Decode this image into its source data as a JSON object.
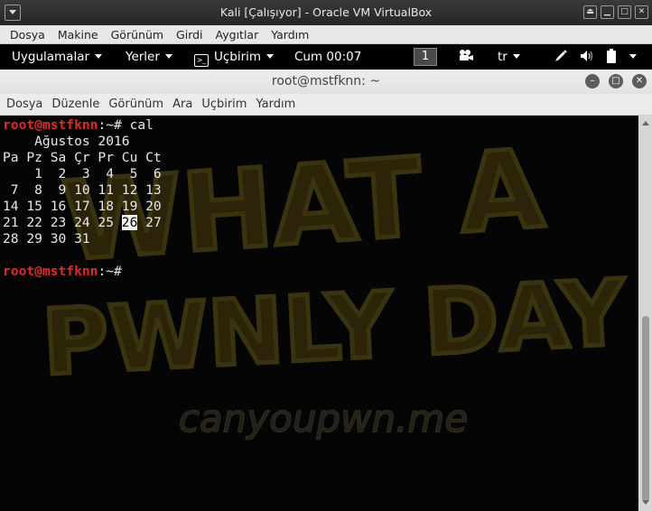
{
  "vbox": {
    "title": "Kali [Çalışıyor] - Oracle VM VirtualBox",
    "menu": [
      "Dosya",
      "Makine",
      "Görünüm",
      "Girdi",
      "Aygıtlar",
      "Yardım"
    ]
  },
  "panel": {
    "applications": "Uygulamalar",
    "places": "Yerler",
    "terminal": "Uçbirim",
    "clock": "Cum 00:07",
    "workspace": "1",
    "keyboard_layout": "tr"
  },
  "terminal_window": {
    "title": "root@mstfknn: ~",
    "menu": [
      "Dosya",
      "Düzenle",
      "Görünüm",
      "Ara",
      "Uçbirim",
      "Yardım"
    ]
  },
  "terminal": {
    "prompt_user": "root@mstfknn",
    "prompt_suffix": ":~# ",
    "command": "cal",
    "cal_header": "    Ağustos 2016",
    "cal_weekdays": "Pa Pz Sa Çr Pr Cu Ct",
    "cal_rows": [
      "    1  2  3  4  5  6",
      " 7  8  9 10 11 12 13",
      "14 15 16 17 18 19 20",
      "28 29 30 31"
    ],
    "cal_row_today_before": "21 22 23 24 25 ",
    "cal_today": "26",
    "cal_row_today_after": " 27",
    "prompt2_user": "root@mstfknn",
    "prompt2_suffix": ":~# "
  },
  "wallpaper": {
    "line1": "WHAT A",
    "line2": "PWNLY DAY",
    "site": "canyoupwn.me"
  },
  "colors": {
    "prompt": "#e02a2a",
    "wallpaper_text": "#2c2408",
    "wallpaper_outline": "#3a3310"
  }
}
